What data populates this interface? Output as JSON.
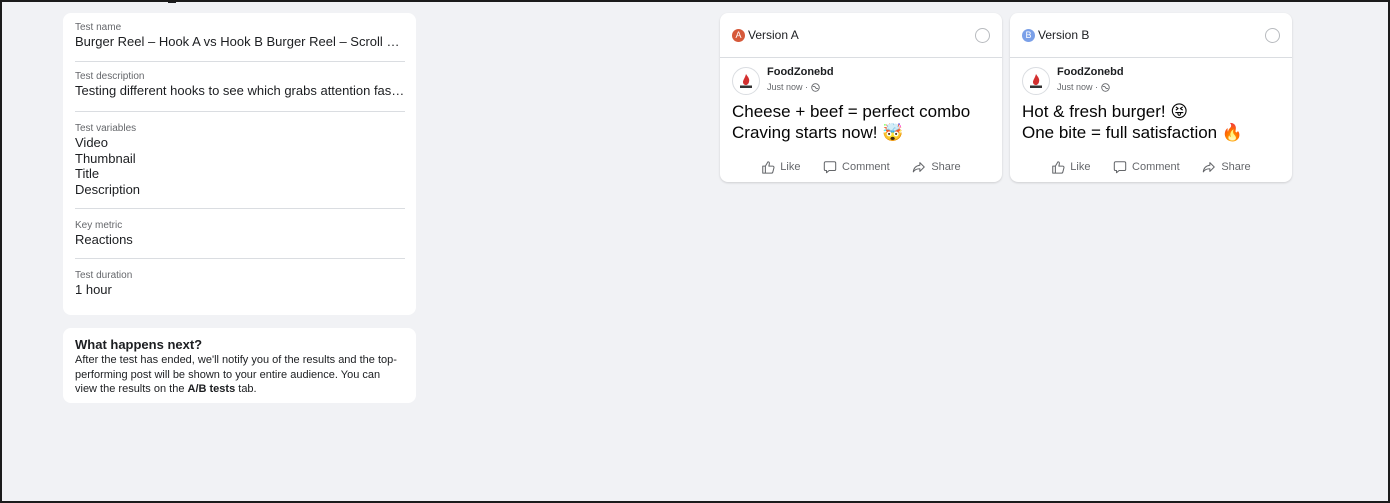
{
  "summary": {
    "fields": [
      {
        "label": "Test name",
        "value": "Burger Reel – Hook A vs Hook B Burger Reel – Scroll Stop..."
      },
      {
        "label": "Test description",
        "value": "Testing different hooks to see which grabs attention faster..."
      },
      {
        "label": "Test variables",
        "values": [
          "Video",
          "Thumbnail",
          "Title",
          "Description"
        ]
      },
      {
        "label": "Key metric",
        "value": "Reactions"
      },
      {
        "label": "Test duration",
        "value": "1 hour"
      }
    ]
  },
  "next": {
    "title": "What happens next?",
    "body_before": "After the test has ended, we'll notify you of the results and the top-performing post will be shown to your entire audience. You can view the results on the ",
    "body_bold": "A/B tests",
    "body_after": " tab."
  },
  "versions": [
    {
      "badge": "A",
      "badge_color": "#d6593a",
      "label": "Version A",
      "page_name": "FoodZonebd",
      "time": "Just now ·",
      "lines": [
        "Cheese + beef = perfect combo",
        "Craving starts now! 🤯"
      ],
      "actions": [
        "Like",
        "Comment",
        "Share"
      ]
    },
    {
      "badge": "B",
      "badge_color": "#7ba0e8",
      "label": "Version B",
      "page_name": "FoodZonebd",
      "time": "Just now ·",
      "lines": [
        "Hot & fresh burger! 😝",
        "One bite = full satisfaction 🔥"
      ],
      "actions": [
        "Like",
        "Comment",
        "Share"
      ]
    }
  ]
}
